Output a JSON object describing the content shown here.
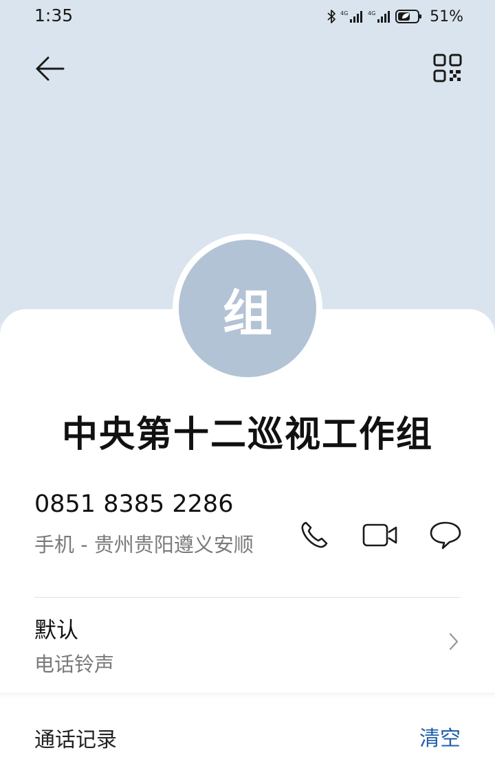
{
  "status_bar": {
    "time": "1:35",
    "battery_percent": "51%",
    "network_1": "4G",
    "network_2": "4G",
    "icons": [
      "bluetooth-icon",
      "signal-icon",
      "signal-icon",
      "battery-saver-icon"
    ]
  },
  "header": {
    "back_icon": "arrow-left-icon",
    "qr_icon": "qr-code-icon"
  },
  "contact": {
    "avatar_letter": "组",
    "name": "中央第十二巡视工作组",
    "phone_number": "0851 8385 2286",
    "phone_desc": "手机 - 贵州贵阳遵义安顺"
  },
  "actions": [
    {
      "name": "call",
      "icon": "phone-icon"
    },
    {
      "name": "video-call",
      "icon": "video-icon"
    },
    {
      "name": "message",
      "icon": "message-icon"
    }
  ],
  "ringtone": {
    "value": "默认",
    "label": "电话铃声"
  },
  "history": {
    "title": "通话记录",
    "clear_label": "清空"
  },
  "colors": {
    "header_bg": "#dae4ee",
    "avatar_bg": "#b3c3d6",
    "accent": "#1f5fa8"
  }
}
